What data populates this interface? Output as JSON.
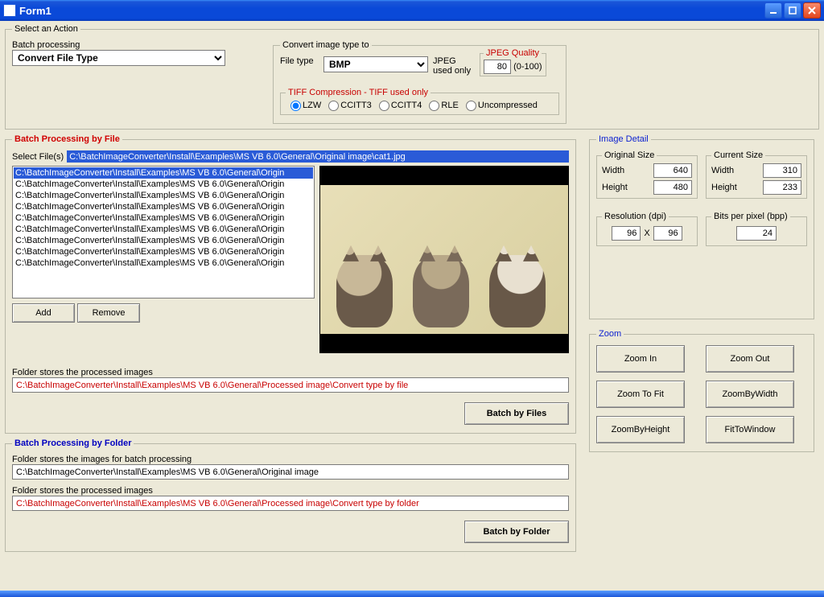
{
  "window": {
    "title": "Form1"
  },
  "action": {
    "legend": "Select an Action",
    "batch_label": "Batch processing",
    "batch_value": "Convert File Type"
  },
  "convert": {
    "legend": "Convert image type to",
    "filetype_label": "File type",
    "filetype_value": "BMP",
    "jpeg_usedonly": "JPEG used only",
    "jpeg_quality_legend": "JPEG Quality",
    "jpeg_quality_value": "80",
    "jpeg_quality_range": "(0-100)",
    "tiff": {
      "legend": "TIFF Compression - TIFF used only",
      "opt1": "LZW",
      "opt2": "CCITT3",
      "opt3": "CCITT4",
      "opt4": "RLE",
      "opt5": "Uncompressed"
    }
  },
  "byfile": {
    "legend": "Batch Processing by File",
    "selectfiles_label": "Select File(s)",
    "selected_path": "C:\\BatchImageConverter\\Install\\Examples\\MS VB 6.0\\General\\Original image\\cat1.jpg",
    "items": [
      "C:\\BatchImageConverter\\Install\\Examples\\MS VB 6.0\\General\\Origin",
      "C:\\BatchImageConverter\\Install\\Examples\\MS VB 6.0\\General\\Origin",
      "C:\\BatchImageConverter\\Install\\Examples\\MS VB 6.0\\General\\Origin",
      "C:\\BatchImageConverter\\Install\\Examples\\MS VB 6.0\\General\\Origin",
      "C:\\BatchImageConverter\\Install\\Examples\\MS VB 6.0\\General\\Origin",
      "C:\\BatchImageConverter\\Install\\Examples\\MS VB 6.0\\General\\Origin",
      "C:\\BatchImageConverter\\Install\\Examples\\MS VB 6.0\\General\\Origin",
      "C:\\BatchImageConverter\\Install\\Examples\\MS VB 6.0\\General\\Origin",
      "C:\\BatchImageConverter\\Install\\Examples\\MS VB 6.0\\General\\Origin"
    ],
    "add": "Add",
    "remove": "Remove",
    "out_label": "Folder stores the processed images",
    "out_path": "C:\\BatchImageConverter\\Install\\Examples\\MS VB 6.0\\General\\Processed image\\Convert type by file",
    "batch_btn": "Batch by Files"
  },
  "byfolder": {
    "legend": "Batch Processing by Folder",
    "in_label": "Folder stores the images for batch processing",
    "in_path": "C:\\BatchImageConverter\\Install\\Examples\\MS VB 6.0\\General\\Original image",
    "out_label": "Folder stores the processed images",
    "out_path": "C:\\BatchImageConverter\\Install\\Examples\\MS VB 6.0\\General\\Processed image\\Convert type by folder",
    "batch_btn": "Batch by Folder"
  },
  "detail": {
    "legend": "Image Detail",
    "orig": {
      "legend": "Original Size",
      "w_label": "Width",
      "w": "640",
      "h_label": "Height",
      "h": "480"
    },
    "cur": {
      "legend": "Current Size",
      "w_label": "Width",
      "w": "310",
      "h_label": "Height",
      "h": "233"
    },
    "res": {
      "legend": "Resolution (dpi)",
      "x": "96",
      "sep": "X",
      "y": "96"
    },
    "bpp": {
      "legend": "Bits per pixel (bpp)",
      "v": "24"
    }
  },
  "zoom": {
    "legend": "Zoom",
    "in": "Zoom In",
    "out": "Zoom Out",
    "fit": "Zoom To Fit",
    "bw": "ZoomByWidth",
    "bh": "ZoomByHeight",
    "ftw": "FitToWindow"
  }
}
